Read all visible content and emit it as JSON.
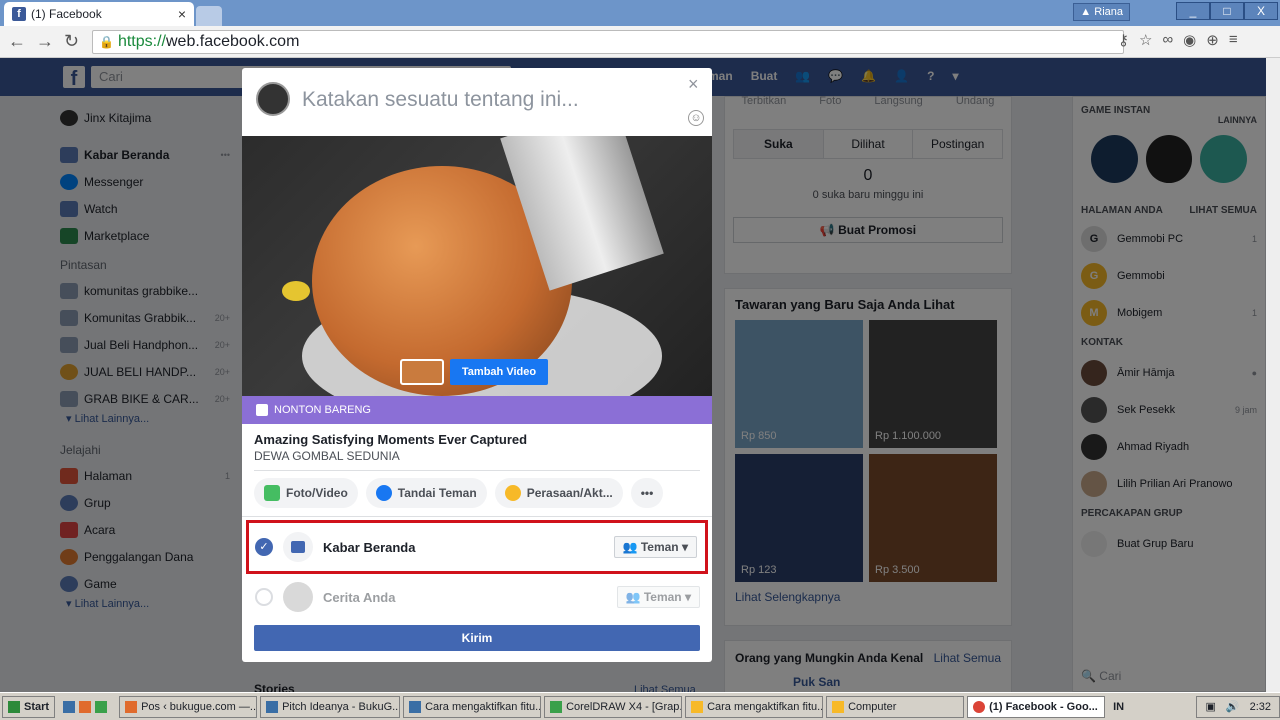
{
  "browser": {
    "tab_title": "(1) Facebook",
    "url_scheme": "https://",
    "url_rest": "web.facebook.com",
    "user": "Riana",
    "win_min": "_",
    "win_max": "□",
    "win_close": "X"
  },
  "fb": {
    "logo": "f",
    "search_placeholder": "Cari",
    "nav": [
      "man",
      "Buat"
    ]
  },
  "left": {
    "profile": "Jinx Kitajima",
    "items": [
      {
        "label": "Kabar Beranda",
        "badge": "•••"
      },
      {
        "label": "Messenger",
        "badge": ""
      },
      {
        "label": "Watch",
        "badge": ""
      },
      {
        "label": "Marketplace",
        "badge": ""
      }
    ],
    "shortcuts_title": "Pintasan",
    "shortcuts": [
      {
        "label": "komunitas grabbike...",
        "badge": ""
      },
      {
        "label": "Komunitas Grabbik...",
        "badge": "20+"
      },
      {
        "label": "Jual Beli Handphon...",
        "badge": "20+"
      },
      {
        "label": "JUAL BELI HANDP...",
        "badge": "20+"
      },
      {
        "label": "GRAB BIKE & CAR...",
        "badge": "20+"
      }
    ],
    "more1": "▾ Lihat Lainnya...",
    "explore_title": "Jelajahi",
    "explore": [
      {
        "label": "Halaman",
        "badge": "1"
      },
      {
        "label": "Grup",
        "badge": ""
      },
      {
        "label": "Acara",
        "badge": ""
      },
      {
        "label": "Penggalangan Dana",
        "badge": ""
      },
      {
        "label": "Game",
        "badge": ""
      }
    ],
    "more2": "▾ Lihat Lainnya...",
    "stories": "Stories",
    "stories_more": "Lihat Semua"
  },
  "middle": {
    "tabs_top": [
      "Terbitkan",
      "Foto",
      "Langsung",
      "Undang"
    ],
    "tabs": [
      "Suka",
      "Dilihat",
      "Postingan"
    ],
    "count": "0",
    "count_label": "0 suka baru minggu ini",
    "promo": "Buat Promosi",
    "offers_title": "Tawaran yang Baru Saja Anda Lihat",
    "prices": [
      "Rp 850",
      "Rp 1.100.000",
      "Rp 123",
      "Rp 3.500"
    ],
    "see_more": "Lihat Selengkapnya",
    "people_title": "Orang yang Mungkin Anda Kenal",
    "people_all": "Lihat Semua",
    "person": "Puk San"
  },
  "right": {
    "games_title": "GAME INSTAN",
    "games_more": "LAINNYA",
    "pages_title": "HALAMAN ANDA",
    "pages_all": "LIHAT SEMUA",
    "pages": [
      {
        "name": "Gemmobi PC",
        "badge": "1",
        "letter": "G"
      },
      {
        "name": "Gemmobi",
        "badge": "",
        "letter": "G"
      },
      {
        "name": "Mobigem",
        "badge": "1",
        "letter": "M"
      }
    ],
    "contacts_title": "KONTAK",
    "contacts": [
      {
        "name": "Āmir Hāmja",
        "meta": "●"
      },
      {
        "name": "Sek Pesekk",
        "meta": "9 jam"
      },
      {
        "name": "Ahmad Riyadh",
        "meta": ""
      },
      {
        "name": "Lilih Prilian Ari Pranowo",
        "meta": ""
      }
    ],
    "groups_title": "PERCAKAPAN GRUP",
    "new_group": "Buat Grup Baru",
    "search": "Cari"
  },
  "modal": {
    "placeholder": "Katakan sesuatu tentang ini...",
    "close": "×",
    "emoji": "☺",
    "add_video": "Tambah Video",
    "watch_party": "NONTON BARENG",
    "video_title": "Amazing Satisfying Moments Ever Captured",
    "video_channel": "DEWA GOMBAL SEDUNIA",
    "actions": [
      "Foto/Video",
      "Tandai Teman",
      "Perasaan/Akt...",
      "•••"
    ],
    "dest1": "Kabar Beranda",
    "dest1_aud": "👥 Teman ▾",
    "check": "✓",
    "dest2": "Cerita Anda",
    "dest2_aud": "👥 Teman ▾",
    "send": "Kirim"
  },
  "taskbar": {
    "start": "Start",
    "items": [
      "Pos ‹ bukugue.com —...",
      "Pitch Ideanya - BukuG...",
      "Cara mengaktifkan fitu...",
      "CorelDRAW X4 - [Grap...",
      "Cara mengaktifkan fitu...",
      "Computer",
      "(1) Facebook - Goo..."
    ],
    "lang": "IN",
    "time": "2:32"
  },
  "colors": {
    "fb_blue": "#3b5998",
    "send": "#4267b2",
    "highlight": "#d0121b",
    "watch_party": "#8b6fd6",
    "add_video": "#1877f2"
  }
}
